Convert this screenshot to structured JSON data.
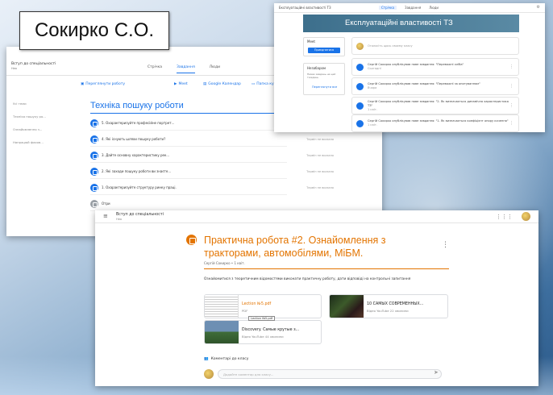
{
  "title_box": {
    "text": "Сокирко С.О."
  },
  "window_left": {
    "course_name": "Вступ до спеціальності",
    "course_sub": "Нео",
    "tabs": [
      "Стрічка",
      "Завдання",
      "Люди"
    ],
    "toolbar": {
      "view_work": "Переглянути роботу",
      "meet": "Meet",
      "calendar": "Google Календар",
      "drive": "Папка курсу"
    },
    "sidebar": [
      "Усі теми",
      "Техніка пошуку ро...",
      "Ознайомлення з...",
      "Напрацюй фахов..."
    ],
    "topic_title": "Техніка пошуку роботи",
    "rows": [
      {
        "text": "5. Охарактеризуйте професійне портрет...",
        "due": "Термін не вказано"
      },
      {
        "text": "4. Які існують шляхи пошуку роботи?",
        "due": "Термін не вказано"
      },
      {
        "text": "3. Дайте основну характеристику рек...",
        "due": "Термін не вказано"
      },
      {
        "text": "2. Які заходи пошуку роботи ви знаєте...",
        "due": "Термін не вказано"
      },
      {
        "text": "1. Охарактеризуйте структуру ринку праці.",
        "due": "Термін не вказано"
      },
      {
        "text": "Отри",
        "due": ""
      }
    ]
  },
  "window_right": {
    "tab_title": "Експлуатаційні властивості ТЗ",
    "tabs": [
      "Стрічка",
      "Завдання",
      "Люди"
    ],
    "banner_title": "Експлуатаційні властивості ТЗ",
    "meet_label": "Meet",
    "meet_button": "Приєднатися",
    "upcoming_title": "Незабаром",
    "upcoming_text": "Немає завдань на цей тиждень",
    "upcoming_link": "Переглянути все",
    "announce_placeholder": "Оголосіть щось своєму класу",
    "posts": [
      {
        "text": "Сергій Сокирко опублікував нове завдання: \"Переважні хліба\"",
        "date": "Сьогодні"
      },
      {
        "text": "Сергій Сокирко опублікував нове завдання: \"Переважні за опитуванням\"",
        "date": "Вчора"
      },
      {
        "text": "Сергій Сокирко опублікував нове завдання: \"2. Як визначається динамічна характеристика ТЗ\"",
        "date": "1 квіт."
      },
      {
        "text": "Сергій Сокирко опублікував нове завдання: \"1. Як визначається коефіцієнт опору кочення\"",
        "date": "1 квіт."
      }
    ]
  },
  "window_bottom": {
    "course_name": "Вступ до спеціальності",
    "course_sub": "Нео",
    "assignment_title": "Практична робота #2. Ознайомлення з тракторами, автомобілями, МіБМ.",
    "author": "Сергій Сокирко • 1 квіт.",
    "description": "Ознайомитися з теоретичним відомостями виконати практичну роботу, дати відповіді на контрольні запитання",
    "attachments": [
      {
        "name": "Lection №5.pdf",
        "type": "PDF"
      },
      {
        "name": "10 САМЫХ СОВРЕМЕННЫХ...",
        "type": "Відео YouTube  22 хвилини"
      },
      {
        "name": "Discovery. Самые крутые з...",
        "type": "Відео YouTube  44 хвилини"
      }
    ],
    "tooltip": "Lection №5.pdf",
    "comments_label": "Коментарі до класу",
    "comment_placeholder": "Додайте коментар для класу..."
  },
  "colors": {
    "accent_blue": "#1a73e8",
    "accent_orange": "#e37400"
  }
}
